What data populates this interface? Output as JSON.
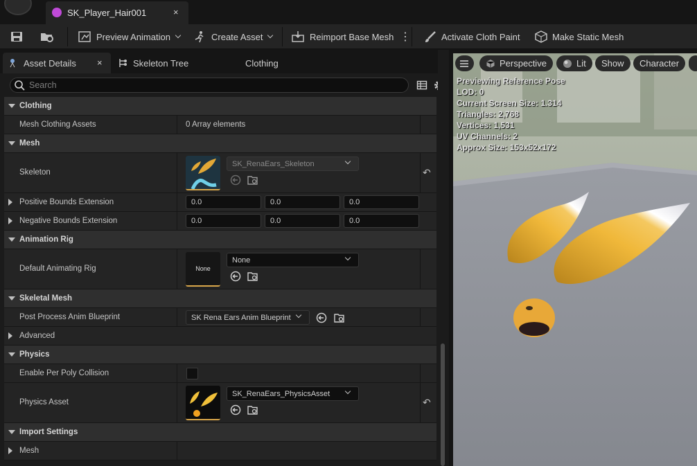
{
  "window": {
    "tab_title": "SK_Player_Hair001",
    "tab_close": "×"
  },
  "toolbar": {
    "preview_animation": "Preview Animation",
    "create_asset": "Create Asset",
    "reimport_base_mesh": "Reimport Base Mesh",
    "activate_cloth_paint": "Activate Cloth Paint",
    "make_static_mesh": "Make Static Mesh",
    "more": "⋮"
  },
  "panel_tabs": {
    "asset_details": "Asset Details",
    "close": "×",
    "skeleton_tree": "Skeleton Tree",
    "clothing": "Clothing"
  },
  "search": {
    "placeholder": "Search"
  },
  "details": {
    "clothing": {
      "header": "Clothing",
      "mesh_clothing_assets": {
        "label": "Mesh Clothing Assets",
        "value": "0 Array elements"
      }
    },
    "mesh": {
      "header": "Mesh",
      "skeleton": {
        "label": "Skeleton",
        "value": "SK_RenaEars_Skeleton"
      },
      "positive_bounds": {
        "label": "Positive Bounds Extension",
        "values": [
          "0.0",
          "0.0",
          "0.0"
        ]
      },
      "negative_bounds": {
        "label": "Negative Bounds Extension",
        "values": [
          "0.0",
          "0.0",
          "0.0"
        ]
      }
    },
    "animation_rig": {
      "header": "Animation Rig",
      "default_rig": {
        "label": "Default Animating Rig",
        "thumb": "None",
        "value": "None"
      }
    },
    "skeletal_mesh": {
      "header": "Skeletal Mesh",
      "post_process": {
        "label": "Post Process Anim Blueprint",
        "value": "SK Rena Ears Anim Blueprint"
      },
      "advanced": "Advanced"
    },
    "physics": {
      "header": "Physics",
      "per_poly": {
        "label": "Enable Per Poly Collision",
        "checked": false
      },
      "physics_asset": {
        "label": "Physics Asset",
        "value": "SK_RenaEars_PhysicsAsset"
      }
    },
    "import_settings": {
      "header": "Import Settings",
      "mesh": "Mesh"
    }
  },
  "viewport": {
    "menu_icon": "hamburger-icon",
    "perspective": "Perspective",
    "lit": "Lit",
    "show": "Show",
    "character": "Character",
    "stats": [
      "Previewing Reference Pose",
      "LOD: 0",
      "Current Screen Size: 1.314",
      "Triangles: 2,768",
      "Vertices: 1,531",
      "UV Channels: 2",
      "Approx Size: 153x52x172"
    ]
  },
  "colors": {
    "accent": "#d9a74a",
    "panel": "#242424",
    "category": "#2f2f2f"
  }
}
